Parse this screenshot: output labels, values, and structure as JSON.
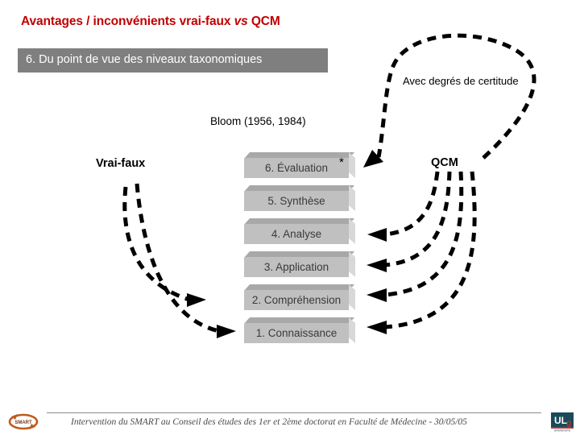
{
  "slide": {
    "title_main": "Avantages / inconvénients vrai-faux ",
    "title_italic": "vs",
    "title_tail": " QCM",
    "title_full": "Avantages / inconvénients vrai-faux vs QCM",
    "section_number_label": "6. Du point de vue des niveaux taxonomiques"
  },
  "labels": {
    "certitude": "Avec degrés de certitude",
    "bloom": "Bloom (1956, 1984)",
    "vrai_faux": "Vrai-faux",
    "qcm": "QCM"
  },
  "taxonomy": {
    "source": "Bloom (1956, 1984)",
    "levels": [
      {
        "text": "6. Évaluation",
        "star": "*"
      },
      {
        "text": "5. Synthèse",
        "star": ""
      },
      {
        "text": "4. Analyse",
        "star": ""
      },
      {
        "text": "3. Application",
        "star": ""
      },
      {
        "text": "2. Compréhension",
        "star": ""
      },
      {
        "text": "1. Connaissance",
        "star": ""
      }
    ]
  },
  "footer": {
    "text": "Intervention du SMART au Conseil des études des 1er et 2ème doctorat en Faculté de Médecine  -  30/05/05",
    "logo_left_text": "SMART",
    "logo_right_text": "ULg"
  },
  "colors": {
    "title_red": "#c00000",
    "section_bar_gray": "#7f7f7f",
    "block_front": "#c0c0c0",
    "block_top": "#a8a8a8",
    "block_side": "#d8d8d8",
    "arrow_black": "#000000",
    "logo_left": "#c05a1e",
    "logo_right": "#1b4a5a"
  }
}
